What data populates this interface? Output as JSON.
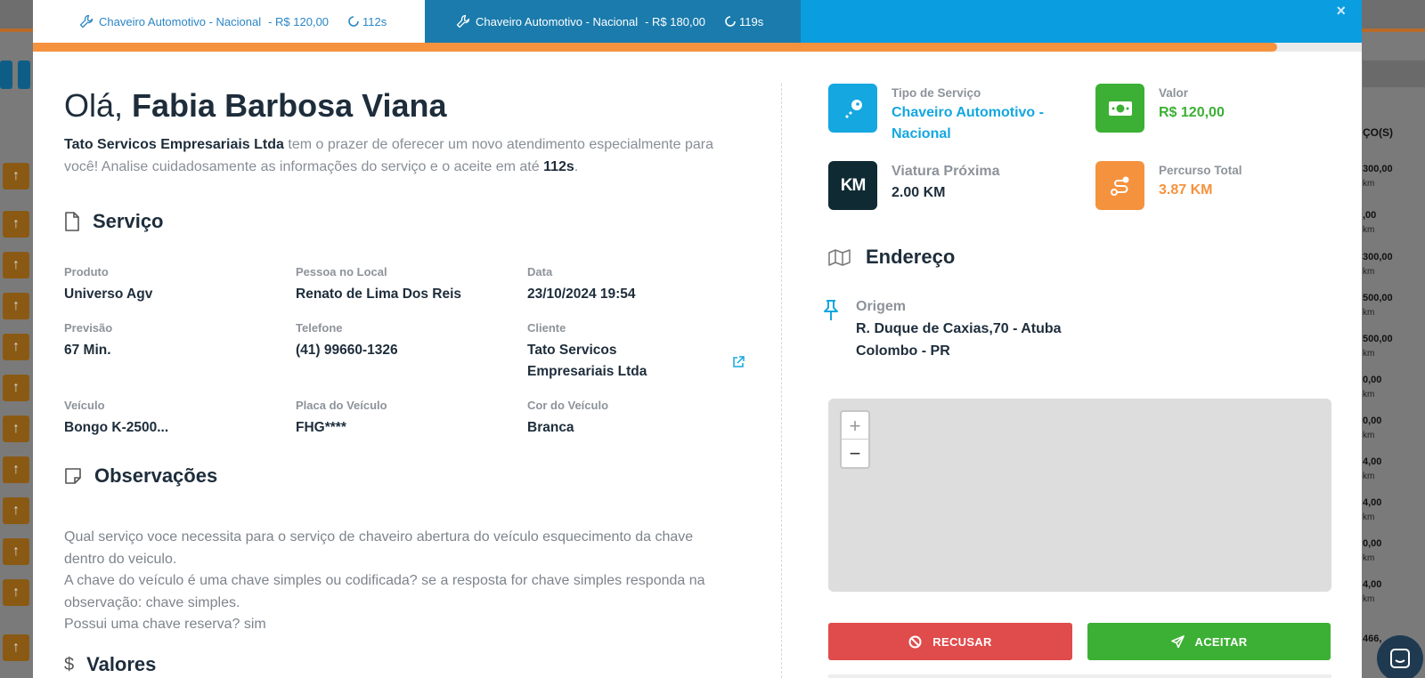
{
  "tabs": [
    {
      "service": "Chaveiro Automotivo - Nacional",
      "price": "- R$ 120,00",
      "timer": "112s"
    },
    {
      "service": "Chaveiro Automotivo - Nacional",
      "price": "- R$ 180,00",
      "timer": "119s"
    }
  ],
  "close_label": "×",
  "progress_fraction": 0.936,
  "greeting": {
    "hello": "Olá,",
    "name": "Fabia Barbosa Viana"
  },
  "intro": {
    "company": "Tato Servicos Empresariais Ltda",
    "text_before": " tem o prazer de oferecer um novo atendimento especialmente para você! Analise cuidadosamente as informações do serviço e o aceite em até ",
    "seconds": "112s",
    "text_after": "."
  },
  "service_section": {
    "title": "Serviço",
    "fields": {
      "produto": {
        "label": "Produto",
        "value": "Universo Agv"
      },
      "pessoa": {
        "label": "Pessoa no Local",
        "value": "Renato de Lima Dos Reis"
      },
      "data": {
        "label": "Data",
        "value": "23/10/2024 19:54"
      },
      "previsao": {
        "label": "Previsão",
        "value": "67 Min."
      },
      "telefone": {
        "label": "Telefone",
        "value": "(41) 99660-1326"
      },
      "cliente": {
        "label": "Cliente",
        "value": "Tato Servicos Empresariais Ltda"
      },
      "veiculo": {
        "label": "Veículo",
        "value": "Bongo K-2500..."
      },
      "placa": {
        "label": "Placa do Veículo",
        "value": "FHG****"
      },
      "cor": {
        "label": "Cor do Veículo",
        "value": "Branca"
      }
    }
  },
  "observations": {
    "title": "Observações",
    "lines": [
      "Qual serviço voce necessita para o serviço de chaveiro abertura do veículo esquecimento da chave dentro do veiculo.",
      "A chave do veículo é uma chave simples ou codificada? se a resposta for chave simples responda na observação: chave simples.",
      "Possui uma chave reserva? sim"
    ]
  },
  "valores": {
    "title": "Valores"
  },
  "summary": {
    "tipo": {
      "label": "Tipo de Serviço",
      "value": "Chaveiro Automotivo - Nacional",
      "color": "#14a7e0"
    },
    "valor": {
      "label": "Valor",
      "value": "R$ 120,00",
      "color": "#3cb034"
    },
    "viatura": {
      "label": "Viatura Próxima",
      "value": "2.00 KM",
      "icon_text": "KM",
      "color": "#1e2d3b"
    },
    "percurso": {
      "label": "Percurso Total",
      "value": "3.87 KM",
      "color": "#f5923e"
    }
  },
  "address": {
    "title": "Endereço",
    "origin_label": "Origem",
    "origin_line1": "R. Duque de Caxias,70 - Atuba",
    "origin_line2": "Colombo - PR"
  },
  "map": {
    "zoom_in": "+",
    "zoom_out": "−"
  },
  "actions": {
    "reject": "RECUSAR",
    "accept": "ACEITAR"
  },
  "background": {
    "column_header": "ÇO(S)",
    "prices": [
      "300,00",
      ",00",
      "300,00",
      "500,00",
      "500,00",
      "0,00",
      "0,00",
      "4,00",
      "4,00",
      "0,00",
      "4,00",
      "466,"
    ],
    "km_suffix": "km"
  },
  "colors": {
    "accent_blue": "#0a9de0",
    "orange": "#f5923e",
    "green": "#3cb034",
    "red": "#e04b4b",
    "dark": "#1e2d3b"
  }
}
